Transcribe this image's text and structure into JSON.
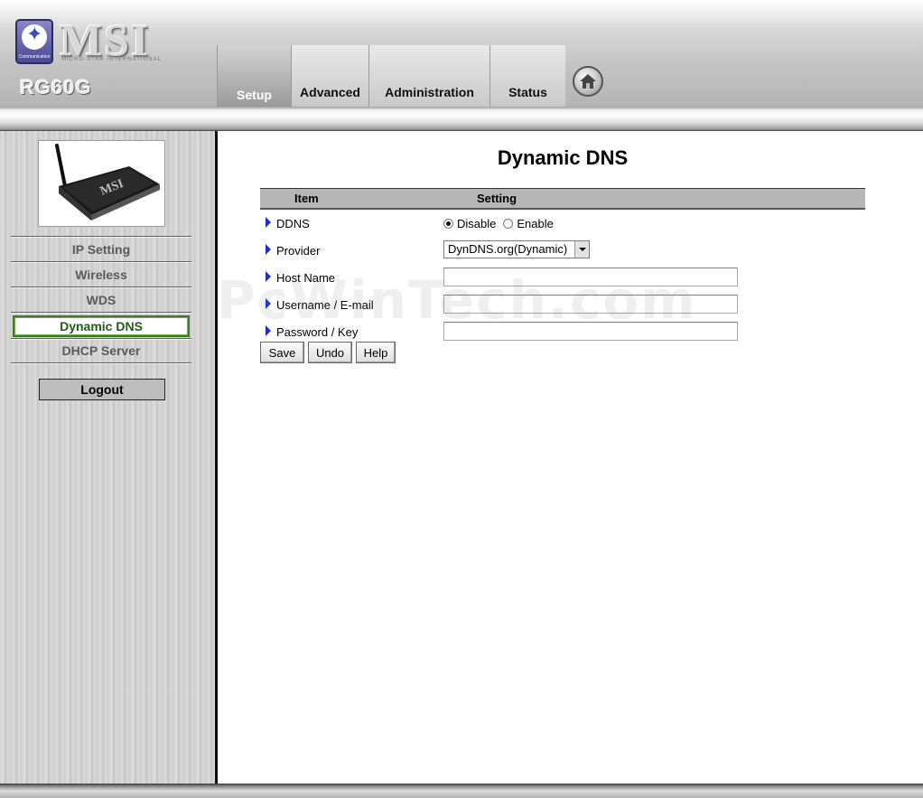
{
  "brand": {
    "logo_text": "MSI",
    "tagline": "MICRO-STAR INTERNATIONAL",
    "badge_text": "Communication",
    "model": "RG60G"
  },
  "nav": {
    "tabs": [
      {
        "label": "Setup",
        "active": true
      },
      {
        "label": "Advanced",
        "active": false
      },
      {
        "label": "Administration",
        "active": false
      },
      {
        "label": "Status",
        "active": false
      }
    ],
    "home_icon": "home-icon"
  },
  "sidebar": {
    "device_image": "msi-router-image",
    "items": [
      {
        "label": "IP Setting",
        "active": false
      },
      {
        "label": "Wireless",
        "active": false
      },
      {
        "label": "WDS",
        "active": false
      },
      {
        "label": "Dynamic DNS",
        "active": true
      },
      {
        "label": "DHCP Server",
        "active": false
      }
    ],
    "logout_label": "Logout"
  },
  "main": {
    "title": "Dynamic DNS",
    "table": {
      "header_item": "Item",
      "header_setting": "Setting"
    },
    "ddns": {
      "label": "DDNS",
      "options": [
        "Disable",
        "Enable"
      ],
      "selected": "Disable"
    },
    "provider": {
      "label": "Provider",
      "value": "DynDNS.org(Dynamic)"
    },
    "host_name": {
      "label": "Host Name",
      "value": ""
    },
    "username": {
      "label": "Username / E-mail",
      "value": ""
    },
    "password": {
      "label": "Password / Key",
      "value": ""
    },
    "buttons": {
      "save": "Save",
      "undo": "Undo",
      "help": "Help"
    }
  },
  "watermark": "PcWinTech.com",
  "colors": {
    "active_menu_border": "#3f7a2c",
    "active_menu_text": "#1f5d12",
    "row_arrow": "#1a33c4",
    "table_header_bg": "#b6b6b6"
  }
}
